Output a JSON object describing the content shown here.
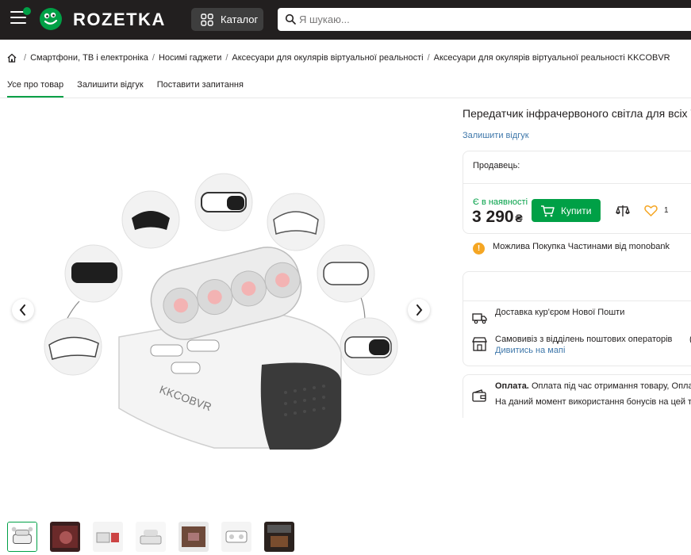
{
  "header": {
    "logo_text": "ROZETKA",
    "catalog_label": "Каталог",
    "search_placeholder": "Я шукаю..."
  },
  "breadcrumbs": [
    "Смартфони, ТВ і електроніка",
    "Носимі гаджети",
    "Аксесуари для окулярів віртуальної реальності",
    "Аксесуари для окулярів віртуальної реальності KKCOBVR"
  ],
  "tabs": [
    {
      "label": "Усе про товар",
      "active": true
    },
    {
      "label": "Залишити відгук",
      "active": false
    },
    {
      "label": "Поставити запитання",
      "active": false
    }
  ],
  "product": {
    "title": "Передатчик інфрачервоного світла для всіх VR",
    "review_link": "Залишити відгук",
    "image_brand": "KKCOBVR",
    "seller_label": "Продавець:",
    "stock_status": "Є в наявності",
    "price": "3 290",
    "currency": "₴",
    "buy_label": "Купити",
    "wishlist_count": "1",
    "monobank_text": "Можлива Покупка Частинами від monobank"
  },
  "delivery": {
    "courier": "Доставка кур'єром Нової Пошти",
    "pickup": "Самовивіз з відділень поштових операторів",
    "map_link": "Дивитись на мапі",
    "edge_char": "("
  },
  "payment": {
    "label": "Оплата.",
    "text": "Оплата під час отримання товару, Оплата на",
    "bonus": "На даний момент використання бонусів на цей товар"
  },
  "colors": {
    "header_bg": "#221f1f",
    "accent_green": "#00a046",
    "link_blue": "#3e77aa"
  }
}
